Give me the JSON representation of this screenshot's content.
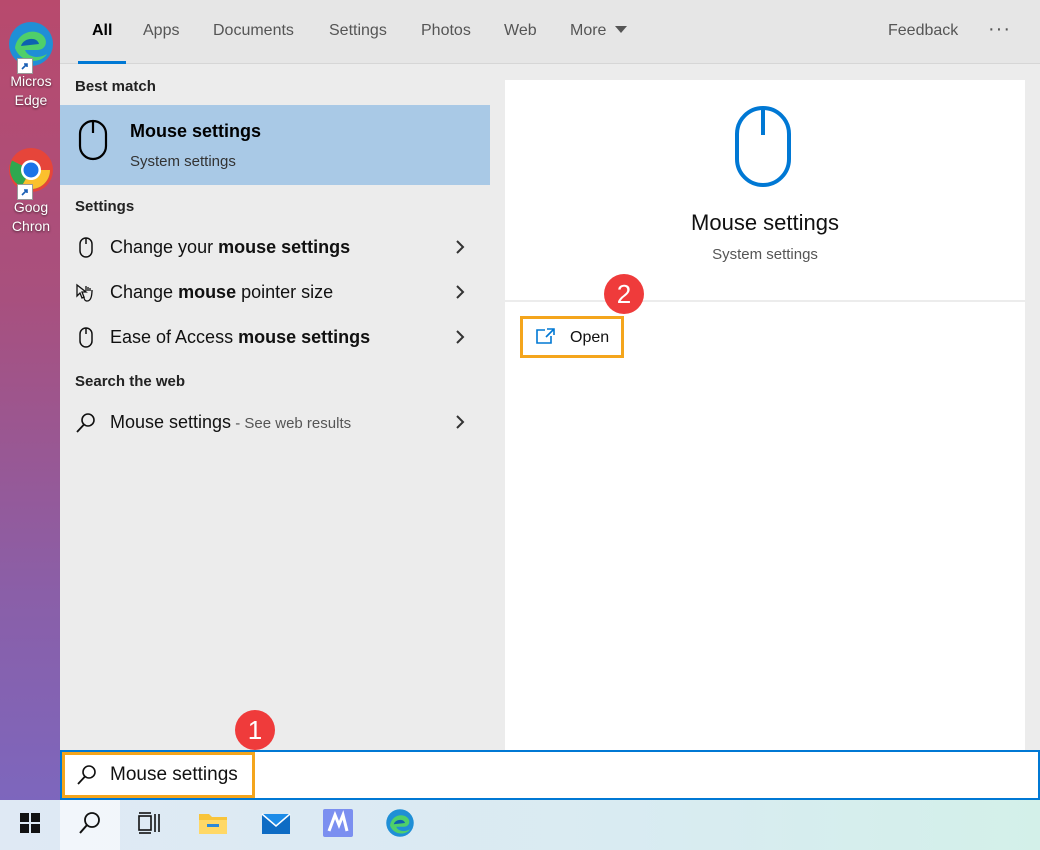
{
  "desktop": {
    "icons": [
      {
        "name": "Microsoft Edge",
        "label_line1": "Micros",
        "label_line2": "Edge"
      },
      {
        "name": "Google Chrome",
        "label_line1": "Goog",
        "label_line2": "Chron"
      }
    ]
  },
  "tabs": [
    {
      "label": "All",
      "active": true
    },
    {
      "label": "Apps"
    },
    {
      "label": "Documents"
    },
    {
      "label": "Settings"
    },
    {
      "label": "Photos"
    },
    {
      "label": "Web"
    },
    {
      "label": "More"
    }
  ],
  "header": {
    "feedback_label": "Feedback",
    "more_options_label": "···"
  },
  "results": {
    "best_match_heading": "Best match",
    "best_match": {
      "title": "Mouse settings",
      "subtitle": "System settings",
      "icon": "mouse-icon"
    },
    "settings_heading": "Settings",
    "settings_items": [
      {
        "prefix": "Change your ",
        "bold": "mouse settings",
        "icon": "mouse-icon"
      },
      {
        "prefix": "Change ",
        "bold": "mouse",
        "suffix": " pointer size",
        "icon": "pointer-hand-icon"
      },
      {
        "prefix": "Ease of Access ",
        "bold": "mouse settings",
        "icon": "mouse-icon"
      }
    ],
    "web_heading": "Search the web",
    "web_item": {
      "text": "Mouse settings",
      "hint": " - See web results",
      "icon": "search-icon"
    }
  },
  "detail": {
    "title": "Mouse settings",
    "subtitle": "System settings",
    "open_label": "Open"
  },
  "badges": {
    "search_step": "1",
    "open_step": "2"
  },
  "search": {
    "value": "Mouse settings"
  },
  "colors": {
    "accent": "#0078d4",
    "highlight": "#f4a51c",
    "badge": "#ef3b3b",
    "selection": "#a9c9e6"
  }
}
